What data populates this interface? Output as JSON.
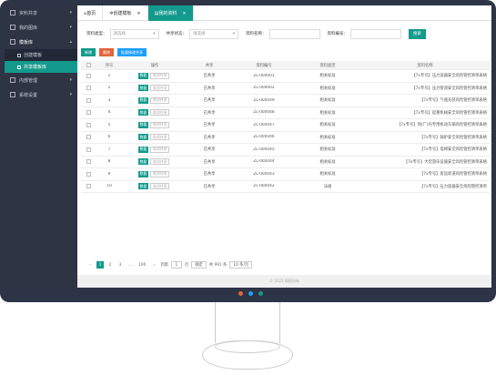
{
  "sidebar": {
    "items": [
      {
        "label": "资料共享",
        "icon": "file-icon"
      },
      {
        "label": "我的图库",
        "icon": "folder-icon"
      },
      {
        "label": "模板库",
        "icon": "grid-icon"
      }
    ],
    "sub_items": [
      {
        "label": "创建模板"
      },
      {
        "label": "共享模板库"
      }
    ],
    "items_after": [
      {
        "label": "内部管理",
        "icon": "doc-icon"
      },
      {
        "label": "系统设置",
        "icon": "gear-icon"
      }
    ]
  },
  "tabs": [
    {
      "label": "首页",
      "icon": "home-icon"
    },
    {
      "label": "创建模板",
      "icon": "settings-icon"
    },
    {
      "label": "我的资料",
      "icon": "doc-icon"
    }
  ],
  "filters": {
    "type_label": "资料类型：",
    "type_value": "请选择",
    "share_label": "共享状态：",
    "share_value": "请选择",
    "name_label": "资料名称：",
    "code_label": "资料编号：",
    "search_label": "搜索"
  },
  "actions": {
    "add": "新增",
    "delete": "删除",
    "batch": "批量修改共享"
  },
  "table": {
    "headers": [
      "序号",
      "操作",
      "共享",
      "资料编号",
      "资料类型",
      "资料名称"
    ],
    "download": "数据",
    "share": "取消共享",
    "rows": [
      {
        "seq": "1",
        "shared": "已共享",
        "code": "ZL-000001",
        "type": "相关标准",
        "name": "【7x专号】压力容器安全风险管控清单表格"
      },
      {
        "seq": "2",
        "shared": "已共享",
        "code": "ZL-000002",
        "type": "相关标准",
        "name": "【7x专号】压力管道安全风险管控清单表格"
      },
      {
        "seq": "3",
        "shared": "已共享",
        "code": "ZL-000049",
        "type": "相关标准",
        "name": "【7x专号】气瓶充装风险管控清单表格"
      },
      {
        "seq": "4",
        "shared": "已共享",
        "code": "ZL-000048",
        "type": "相关标准",
        "name": "【7x专号】起重机械安全风险管控清单表格"
      },
      {
        "seq": "5",
        "shared": "已共享",
        "code": "ZL-000047",
        "type": "相关标准",
        "name": "【7x专号】场(厂)内专用机动车辆风险管控清单表格"
      },
      {
        "seq": "6",
        "shared": "已共享",
        "code": "ZL-000046",
        "type": "相关标准",
        "name": "【7x专号】锅炉安全风险管控清单表格"
      },
      {
        "seq": "7",
        "shared": "已共享",
        "code": "ZL-000045",
        "type": "相关标准",
        "name": "【7x专号】电梯安全风险管控清单表格"
      },
      {
        "seq": "8",
        "shared": "已共享",
        "code": "ZL-000044",
        "type": "相关标准",
        "name": "【7x专号】大型游乐设施安全风险管控清单表格"
      },
      {
        "seq": "9",
        "shared": "已共享",
        "code": "ZL-000043",
        "type": "相关标准",
        "name": "【7x专号】客运索道风险管控清单表格"
      },
      {
        "seq": "10",
        "shared": "已共享",
        "code": "ZL-000042",
        "type": "法规",
        "name": "【7x专号】压力容器安全风险管控清单"
      }
    ]
  },
  "pager": {
    "prev": "‹",
    "pages": [
      "1",
      "2",
      "3",
      "...",
      "100"
    ],
    "next": "›",
    "goto": "到第",
    "page_value": "1",
    "page_unit": "页",
    "confirm": "确定",
    "total": "共 991 条",
    "per_page": "10 条/页"
  },
  "footer": {
    "text": "© 2022 版权所有"
  },
  "colors": {
    "accent": "#139a8c",
    "danger": "#e4643b",
    "info": "#1e9fff",
    "frame": "#2d3446"
  }
}
